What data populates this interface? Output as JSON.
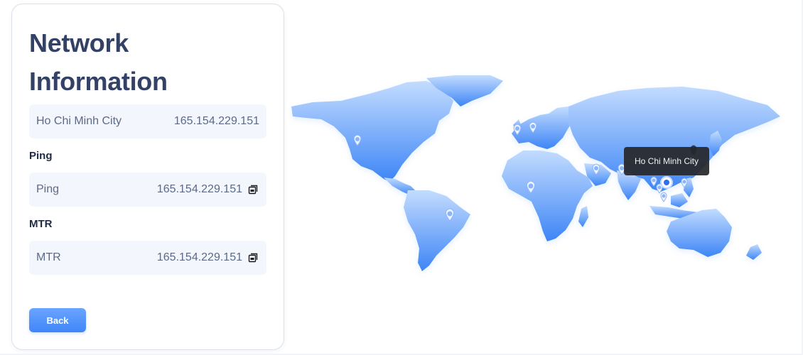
{
  "panel": {
    "title_line1": "Network",
    "title_line2": "Information",
    "location_row": {
      "label": "Ho Chi Minh City",
      "value": "165.154.229.151"
    },
    "ping": {
      "section_label": "Ping",
      "label": "Ping",
      "value": "165.154.229.151",
      "icon": "copy-icon"
    },
    "mtr": {
      "section_label": "MTR",
      "label": "MTR",
      "value": "165.154.229.151",
      "icon": "copy-icon"
    },
    "back_label": "Back"
  },
  "map": {
    "tooltip": "Ho Chi Minh City",
    "gradient_top": "#c3dcfe",
    "gradient_bottom": "#3d85f6",
    "markers": [
      "marker-pin-icon"
    ]
  }
}
